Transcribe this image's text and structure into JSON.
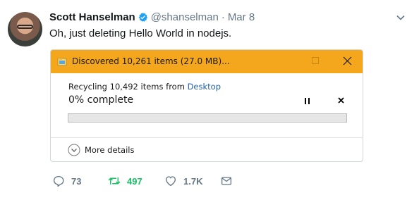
{
  "tweet": {
    "author_name": "Scott Hanselman",
    "handle": "@shanselman",
    "separator": "·",
    "date": "Mar 8",
    "text": "Oh, just deleting Hello World in nodejs."
  },
  "dialog": {
    "title": "Discovered 10,261 items (27.0 MB)...",
    "recycling_prefix": "Recycling 10,492 items from ",
    "recycling_source": "Desktop",
    "percent_text": "0% complete",
    "progress": 0,
    "more_details": "More details"
  },
  "actions": {
    "replies": "73",
    "retweets": "497",
    "likes": "1.7K"
  },
  "colors": {
    "titlebar": "#f4a71d",
    "verified": "#1da1f2",
    "retweet": "#17bf63",
    "muted": "#657786",
    "link": "#1f5fa8"
  }
}
